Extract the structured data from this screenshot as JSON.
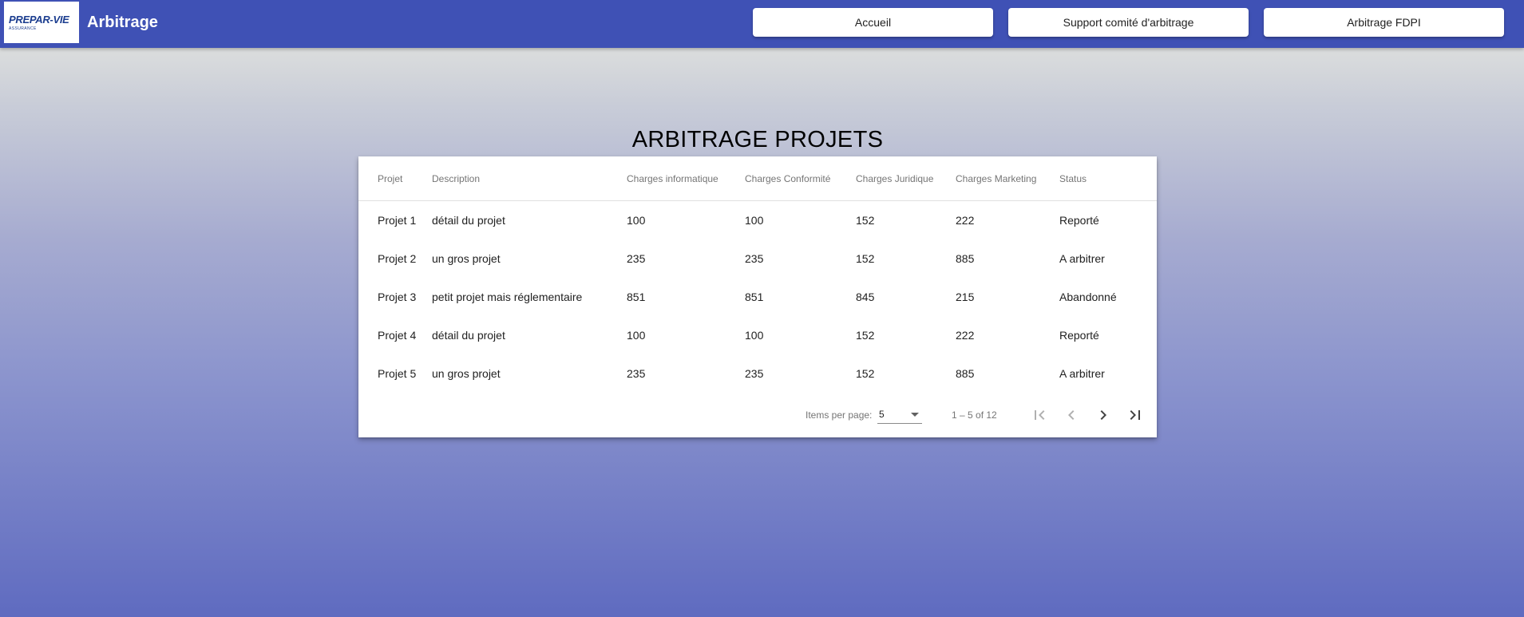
{
  "toolbar": {
    "logo": {
      "main": "PREPAR-VIE",
      "sub": "ASSURANCE"
    },
    "title": "Arbitrage",
    "nav": [
      {
        "label": "Accueil"
      },
      {
        "label": "Support comité d'arbitrage"
      },
      {
        "label": "Arbitrage FDPI"
      }
    ],
    "background_color": "#3f51b5"
  },
  "page": {
    "title": "ARBITRAGE PROJETS"
  },
  "table": {
    "columns": [
      "Projet",
      "Description",
      "Charges informatique",
      "Charges Conformité",
      "Charges Juridique",
      "Charges Marketing",
      "Status"
    ],
    "rows": [
      [
        "Projet 1",
        "détail du projet",
        "100",
        "100",
        "152",
        "222",
        "Reporté"
      ],
      [
        "Projet 2",
        "un gros projet",
        "235",
        "235",
        "152",
        "885",
        "A arbitrer"
      ],
      [
        "Projet 3",
        "petit projet mais réglementaire",
        "851",
        "851",
        "845",
        "215",
        "Abandonné"
      ],
      [
        "Projet 4",
        "détail du projet",
        "100",
        "100",
        "152",
        "222",
        "Reporté"
      ],
      [
        "Projet 5",
        "un gros projet",
        "235",
        "235",
        "152",
        "885",
        "A arbitrer"
      ]
    ]
  },
  "paginator": {
    "items_per_page_label": "Items per page:",
    "page_size": "5",
    "range_label": "1 – 5 of 12",
    "icons": [
      "first-page-icon",
      "previous-page-icon",
      "next-page-icon",
      "last-page-icon"
    ]
  }
}
